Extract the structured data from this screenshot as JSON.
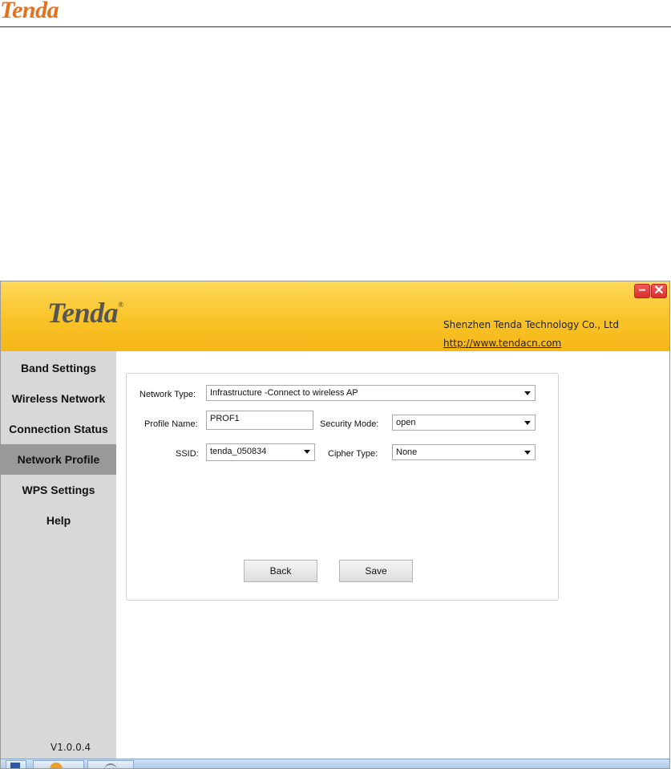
{
  "document": {
    "logo": "Tenda"
  },
  "app": {
    "logo": "Tenda",
    "logo_mark": "®",
    "company": "Shenzhen Tenda Technology Co., Ltd",
    "website": "http://www.tendacn.com",
    "minimize_label": "−",
    "close_label": "✕",
    "version": "V1.0.0.4"
  },
  "sidebar": {
    "items": [
      {
        "label": "Band Settings",
        "active": false
      },
      {
        "label": "Wireless Network",
        "active": false
      },
      {
        "label": "Connection Status",
        "active": false
      },
      {
        "label": "Network Profile",
        "active": true
      },
      {
        "label": "WPS Settings",
        "active": false
      },
      {
        "label": "Help",
        "active": false
      }
    ]
  },
  "form": {
    "network_type_label": "Network Type:",
    "network_type_value": "Infrastructure -Connect to wireless AP",
    "profile_name_label": "Profile Name:",
    "profile_name_value": "PROF1",
    "security_mode_label": "Security Mode:",
    "security_mode_value": "open",
    "ssid_label": "SSID:",
    "ssid_value": "tenda_050834",
    "cipher_type_label": "Cipher Type:",
    "cipher_type_value": "None",
    "back_label": "Back",
    "save_label": "Save"
  },
  "colors": {
    "banner": "#f8c327",
    "sidebar": "#d8d8d8",
    "sidebar_active": "#999999",
    "logo_orange": "#e8701a"
  },
  "taskbar": {
    "icons": [
      "app-icon",
      "folder-icon",
      "network-icon"
    ]
  }
}
